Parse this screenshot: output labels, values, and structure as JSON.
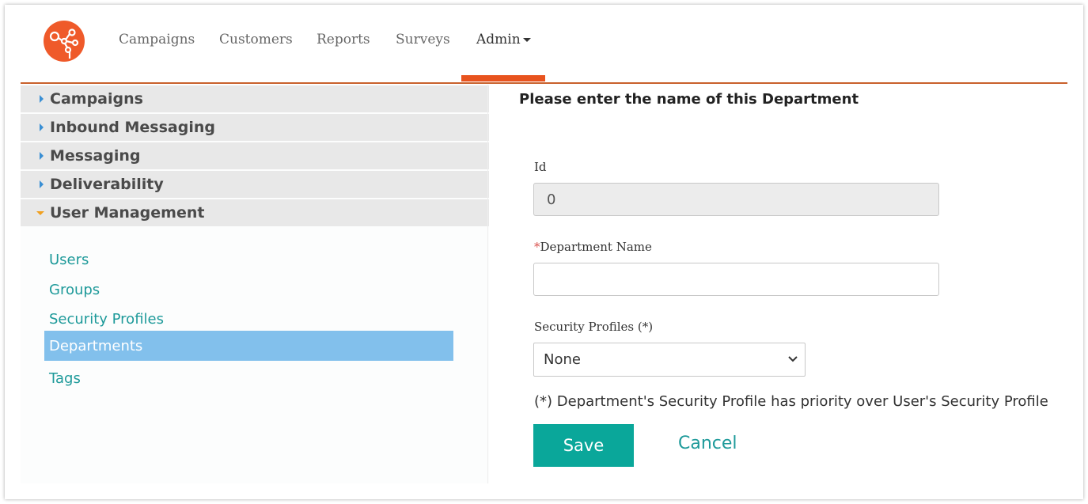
{
  "nav": {
    "logo_icon": "network-logo-icon",
    "brand_color": "#e8531e",
    "items": [
      {
        "label": "Campaigns"
      },
      {
        "label": "Customers"
      },
      {
        "label": "Reports"
      },
      {
        "label": "Surveys"
      },
      {
        "label": "Admin"
      }
    ],
    "active": "Admin"
  },
  "sidebar": {
    "sections": [
      {
        "label": "Campaigns",
        "expanded": false
      },
      {
        "label": "Inbound Messaging",
        "expanded": false
      },
      {
        "label": "Messaging",
        "expanded": false
      },
      {
        "label": "Deliverability",
        "expanded": false
      },
      {
        "label": "User Management",
        "expanded": true
      }
    ],
    "sub_items": [
      {
        "label": "Users"
      },
      {
        "label": "Groups"
      },
      {
        "label": "Security Profiles"
      },
      {
        "label": "Departments"
      },
      {
        "label": "Tags"
      }
    ],
    "selected": "Departments",
    "selected_color": "#82c0ec"
  },
  "form": {
    "title": "Please enter the name of this Department",
    "id_label": "Id",
    "id_value": "0",
    "required_marker": "*",
    "name_label": "Department Name",
    "name_value": "",
    "security_label": "Security Profiles (*)",
    "security_value": "None",
    "note": "(*) Department's Security Profile has priority over User's Security Profile",
    "save_label": "Save",
    "cancel_label": "Cancel",
    "accent_color": "#0aa79a"
  }
}
